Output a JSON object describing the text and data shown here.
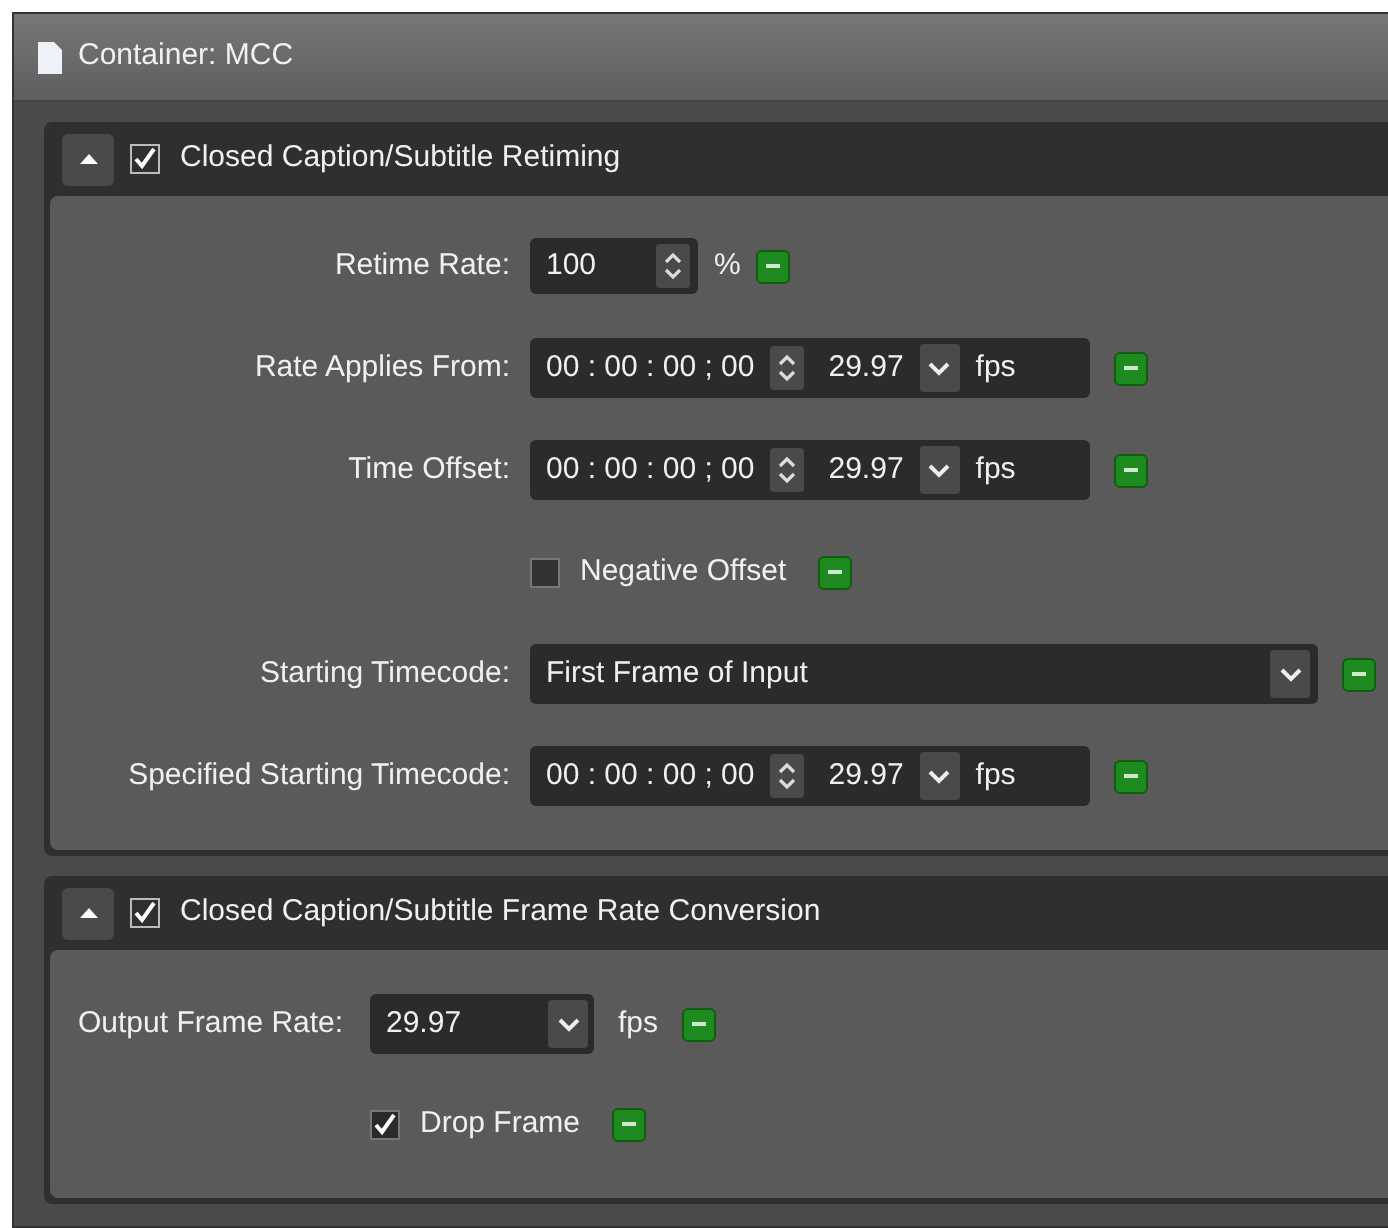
{
  "window": {
    "title": "Container: MCC"
  },
  "sections": [
    {
      "title": "Closed Caption/Subtitle Retiming",
      "checked": true,
      "kind": "form",
      "rows": [
        {
          "kind": "spin",
          "label": "Retime Rate:",
          "value": "100",
          "unit": "%"
        },
        {
          "kind": "timecode",
          "label": "Rate Applies From:",
          "value": "00 : 00 : 00 ; 00",
          "rate": "29.97",
          "unit": "fps"
        },
        {
          "kind": "timecode",
          "label": "Time Offset:",
          "value": "00 : 00 : 00 ; 00",
          "rate": "29.97",
          "unit": "fps"
        },
        {
          "kind": "checkbox",
          "label": "Negative Offset",
          "checked": false
        },
        {
          "kind": "dropdown",
          "label": "Starting Timecode:",
          "value": "First Frame of Input"
        },
        {
          "kind": "timecode",
          "label": "Specified Starting Timecode:",
          "value": "00 : 00 : 00 ; 00",
          "rate": "29.97",
          "unit": "fps"
        }
      ]
    },
    {
      "title": "Closed Caption/Subtitle Frame Rate Conversion",
      "checked": true,
      "kind": "compact",
      "rows": [
        {
          "kind": "select",
          "label": "Output Frame Rate:",
          "value": "29.97",
          "unit": "fps"
        },
        {
          "kind": "checkbox",
          "label": "Drop Frame",
          "checked": true
        }
      ]
    }
  ]
}
